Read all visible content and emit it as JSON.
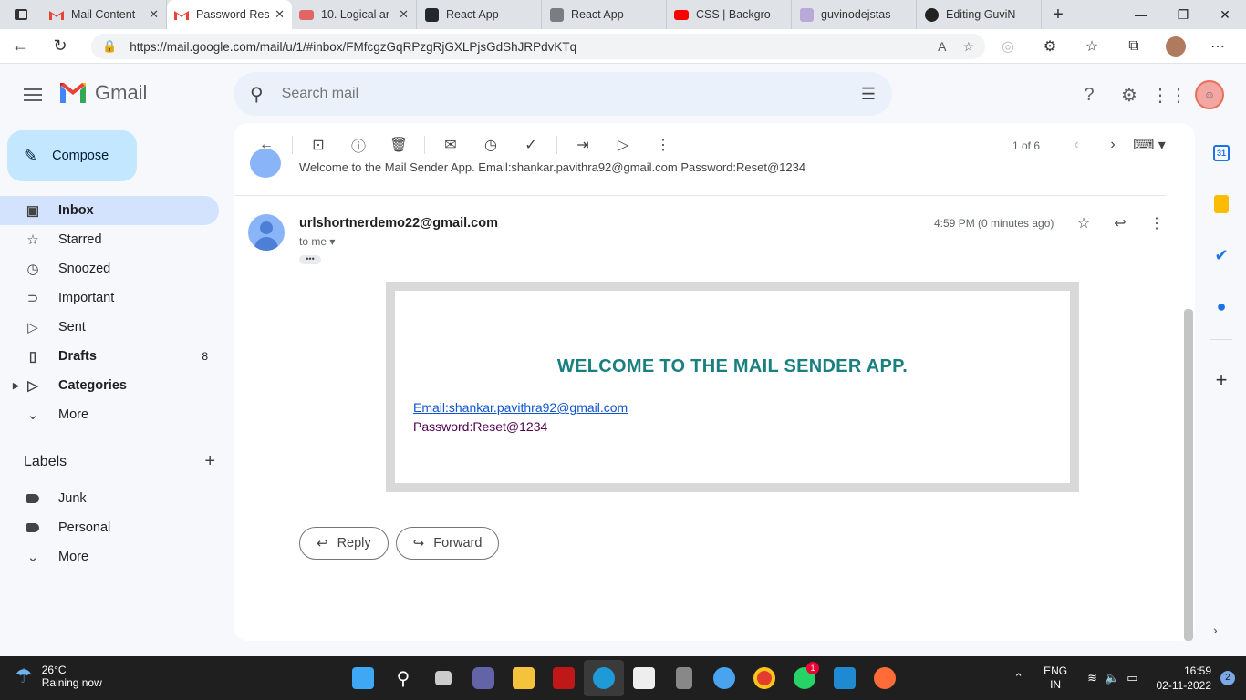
{
  "browser": {
    "tabs": [
      {
        "title": "Mail Content",
        "favicon": "gmail-icon",
        "active": false
      },
      {
        "title": "Password Res",
        "favicon": "gmail-icon",
        "active": true
      },
      {
        "title": "10. Logical ar",
        "favicon": "youtube-icon",
        "active": false
      },
      {
        "title": "React App",
        "favicon": "react-icon",
        "active": false
      },
      {
        "title": "React App",
        "favicon": "react-icon",
        "active": false
      },
      {
        "title": "CSS | Backgro",
        "favicon": "youtube-icon",
        "active": false
      },
      {
        "title": "guvinodejstas",
        "favicon": "heroku-icon",
        "active": false
      },
      {
        "title": "Editing GuviN",
        "favicon": "github-icon",
        "active": false
      }
    ],
    "url": "https://mail.google.com/mail/u/1/#inbox/FMfcgzGqRPzgRjGXLPjsGdShJRPdvKTq"
  },
  "gmail": {
    "product_name": "Gmail",
    "search_placeholder": "Search mail",
    "compose_label": "Compose",
    "nav": [
      {
        "label": "Inbox",
        "icon": "inbox-icon",
        "active": true,
        "bold": true,
        "count": ""
      },
      {
        "label": "Starred",
        "icon": "star-icon",
        "active": false,
        "bold": false,
        "count": ""
      },
      {
        "label": "Snoozed",
        "icon": "clock-icon",
        "active": false,
        "bold": false,
        "count": ""
      },
      {
        "label": "Important",
        "icon": "important-icon",
        "active": false,
        "bold": false,
        "count": ""
      },
      {
        "label": "Sent",
        "icon": "send-icon",
        "active": false,
        "bold": false,
        "count": ""
      },
      {
        "label": "Drafts",
        "icon": "draft-icon",
        "active": false,
        "bold": true,
        "count": "8"
      },
      {
        "label": "Categories",
        "icon": "label-icon",
        "active": false,
        "bold": true,
        "count": ""
      },
      {
        "label": "More",
        "icon": "chevron-down-icon",
        "active": false,
        "bold": false,
        "count": ""
      }
    ],
    "labels_title": "Labels",
    "labels": [
      {
        "label": "Junk",
        "icon": "label-filled-icon"
      },
      {
        "label": "Personal",
        "icon": "label-filled-icon"
      },
      {
        "label": "More",
        "icon": "chevron-down-icon"
      }
    ],
    "pager": "1 of 6"
  },
  "message": {
    "previous_snippet": "Welcome to the Mail Sender App. Email:shankar.pavithra92@gmail.com Password:Reset@1234",
    "sender": "urlshortnerdemo22@gmail.com",
    "recipient": "to me",
    "time": "4:59 PM (0 minutes ago)",
    "body": {
      "heading": "WELCOME TO THE MAIL SENDER APP.",
      "email_line": "Email:shankar.pavithra92@gmail.com",
      "password_line": "Password:Reset@1234"
    },
    "reply_label": "Reply",
    "forward_label": "Forward"
  },
  "taskbar": {
    "temperature": "26°C",
    "weather": "Raining now",
    "lang": "ENG",
    "region": "IN",
    "time": "16:59",
    "date": "02-11-2022",
    "notifications": "2",
    "whatsapp_badge": "1"
  },
  "colors": {
    "heading_teal": "#1a7f7f",
    "compose_bg": "#c2e7ff",
    "active_nav": "#d3e3fd",
    "search_bg": "#eaf1fb"
  }
}
